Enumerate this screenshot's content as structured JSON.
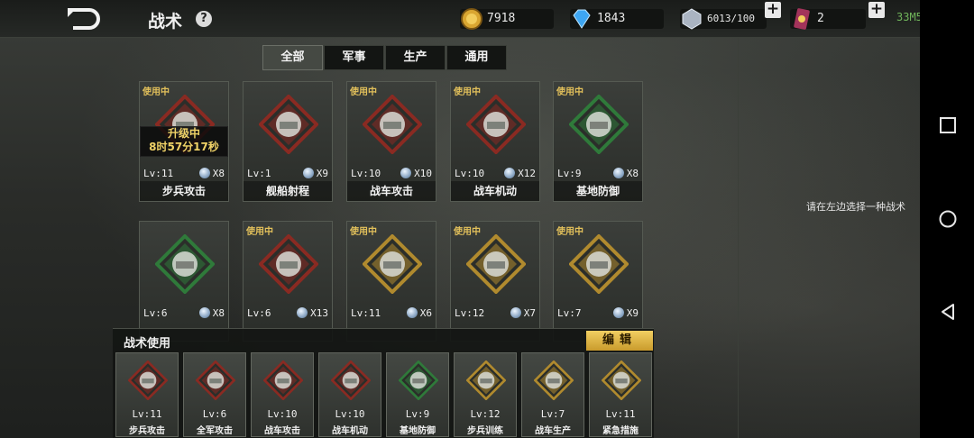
{
  "header": {
    "title": "战术",
    "help_label": "?",
    "gold": "7918",
    "diamonds": "1843",
    "silver": "6013/100",
    "medals": "2",
    "clock": "33M5"
  },
  "tabs": [
    {
      "label": "全部",
      "active": true
    },
    {
      "label": "军事",
      "active": false
    },
    {
      "label": "生产",
      "active": false
    },
    {
      "label": "通用",
      "active": false
    }
  ],
  "in_use_label": "使用中",
  "upgrade": {
    "line1": "升级中",
    "line2": "8时57分17秒"
  },
  "tactics": [
    {
      "name": "步兵攻击",
      "level": "Lv:11",
      "count": "X8",
      "in_use": true,
      "frame": "red"
    },
    {
      "name": "舰船射程",
      "level": "Lv:1",
      "count": "X9",
      "in_use": false,
      "frame": "red"
    },
    {
      "name": "战车攻击",
      "level": "Lv:10",
      "count": "X10",
      "in_use": true,
      "frame": "red"
    },
    {
      "name": "战车机动",
      "level": "Lv:10",
      "count": "X12",
      "in_use": true,
      "frame": "red"
    },
    {
      "name": "基地防御",
      "level": "Lv:9",
      "count": "X8",
      "in_use": true,
      "frame": "green"
    },
    {
      "name": "",
      "level": "Lv:6",
      "count": "X8",
      "in_use": false,
      "frame": "green"
    },
    {
      "name": "",
      "level": "Lv:6",
      "count": "X13",
      "in_use": true,
      "frame": "red"
    },
    {
      "name": "",
      "level": "Lv:11",
      "count": "X6",
      "in_use": true,
      "frame": "gold"
    },
    {
      "name": "",
      "level": "Lv:12",
      "count": "X7",
      "in_use": true,
      "frame": "gold"
    },
    {
      "name": "",
      "level": "Lv:7",
      "count": "X9",
      "in_use": true,
      "frame": "gold"
    }
  ],
  "loadout": {
    "title": "战术使用",
    "edit_label": "编辑",
    "slots": [
      {
        "name": "步兵攻击",
        "level": "Lv:11",
        "frame": "red"
      },
      {
        "name": "全军攻击",
        "level": "Lv:6",
        "frame": "red"
      },
      {
        "name": "战车攻击",
        "level": "Lv:10",
        "frame": "red"
      },
      {
        "name": "战车机动",
        "level": "Lv:10",
        "frame": "red"
      },
      {
        "name": "基地防御",
        "level": "Lv:9",
        "frame": "green"
      },
      {
        "name": "步兵训练",
        "level": "Lv:12",
        "frame": "gold"
      },
      {
        "name": "战车生产",
        "level": "Lv:7",
        "frame": "gold"
      },
      {
        "name": "紧急措施",
        "level": "Lv:11",
        "frame": "gold"
      }
    ]
  },
  "detail": {
    "hint": "请在左边选择一种战术"
  },
  "colors": {
    "red": "#8a2a22",
    "green": "#2f7a3a",
    "gold": "#b08a2e",
    "accent": "#f2cf62"
  }
}
